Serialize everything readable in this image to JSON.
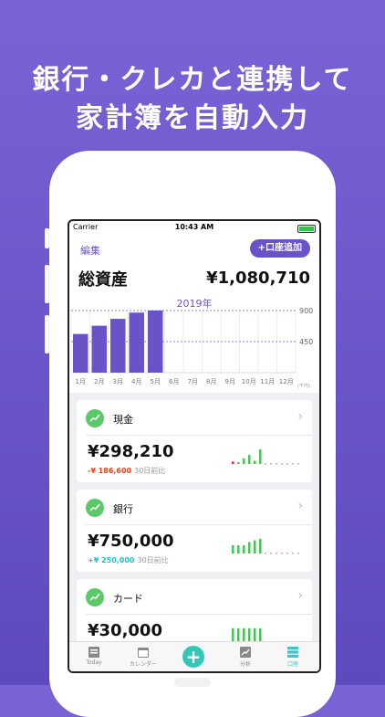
{
  "headline": {
    "line1": "銀行・クレカと連携して",
    "line2": "家計簿を自動入力"
  },
  "status": {
    "carrier": "Carrier",
    "time": "10:43 AM"
  },
  "header": {
    "edit": "編集",
    "add_account": "+口座追加"
  },
  "summary": {
    "label": "総資産",
    "value": "¥1,080,710"
  },
  "chart_data": {
    "type": "bar",
    "title": "2019年",
    "categories": [
      "1月",
      "2月",
      "3月",
      "4月",
      "5月",
      "6月",
      "7月",
      "8月",
      "9月",
      "10月",
      "11月",
      "12月"
    ],
    "values": [
      560,
      680,
      780,
      870,
      900,
      null,
      null,
      null,
      null,
      null,
      null,
      null
    ],
    "ylim": [
      0,
      900
    ],
    "yticks": [
      "900",
      "450"
    ],
    "unit": "(千円)",
    "bar_color": "#6a53c9"
  },
  "accounts": [
    {
      "name": "現金",
      "amount": "¥298,210",
      "diff": "-¥ 186,600",
      "diff_note": "30日前比",
      "diff_color": "#e8451e",
      "spark": [
        0.15,
        0.0,
        0.35,
        0.55,
        0.2,
        0.9
      ]
    },
    {
      "name": "銀行",
      "amount": "¥750,000",
      "diff": "+¥ 250,000",
      "diff_note": "30日前比",
      "diff_color": "#21bfc0",
      "spark": [
        0.5,
        0.5,
        0.5,
        0.7,
        0.8,
        0.9
      ]
    },
    {
      "name": "カード",
      "amount": "¥30,000",
      "diff": "",
      "diff_note": "",
      "diff_color": "#21bfc0",
      "spark": [
        0.9,
        0.9,
        0.9,
        0.9,
        0.9,
        0.9
      ]
    }
  ],
  "tabs": [
    {
      "label": "Today",
      "icon": "today-icon"
    },
    {
      "label": "カレンダー",
      "icon": "calendar-icon"
    },
    {
      "label": "",
      "icon": "plus-icon"
    },
    {
      "label": "分析",
      "icon": "analysis-icon"
    },
    {
      "label": "口座",
      "icon": "accounts-icon"
    }
  ],
  "colors": {
    "accent": "#6a53c9",
    "green": "#5bc86a",
    "spark": "#4cc15a",
    "teal": "#3ec6c6"
  }
}
